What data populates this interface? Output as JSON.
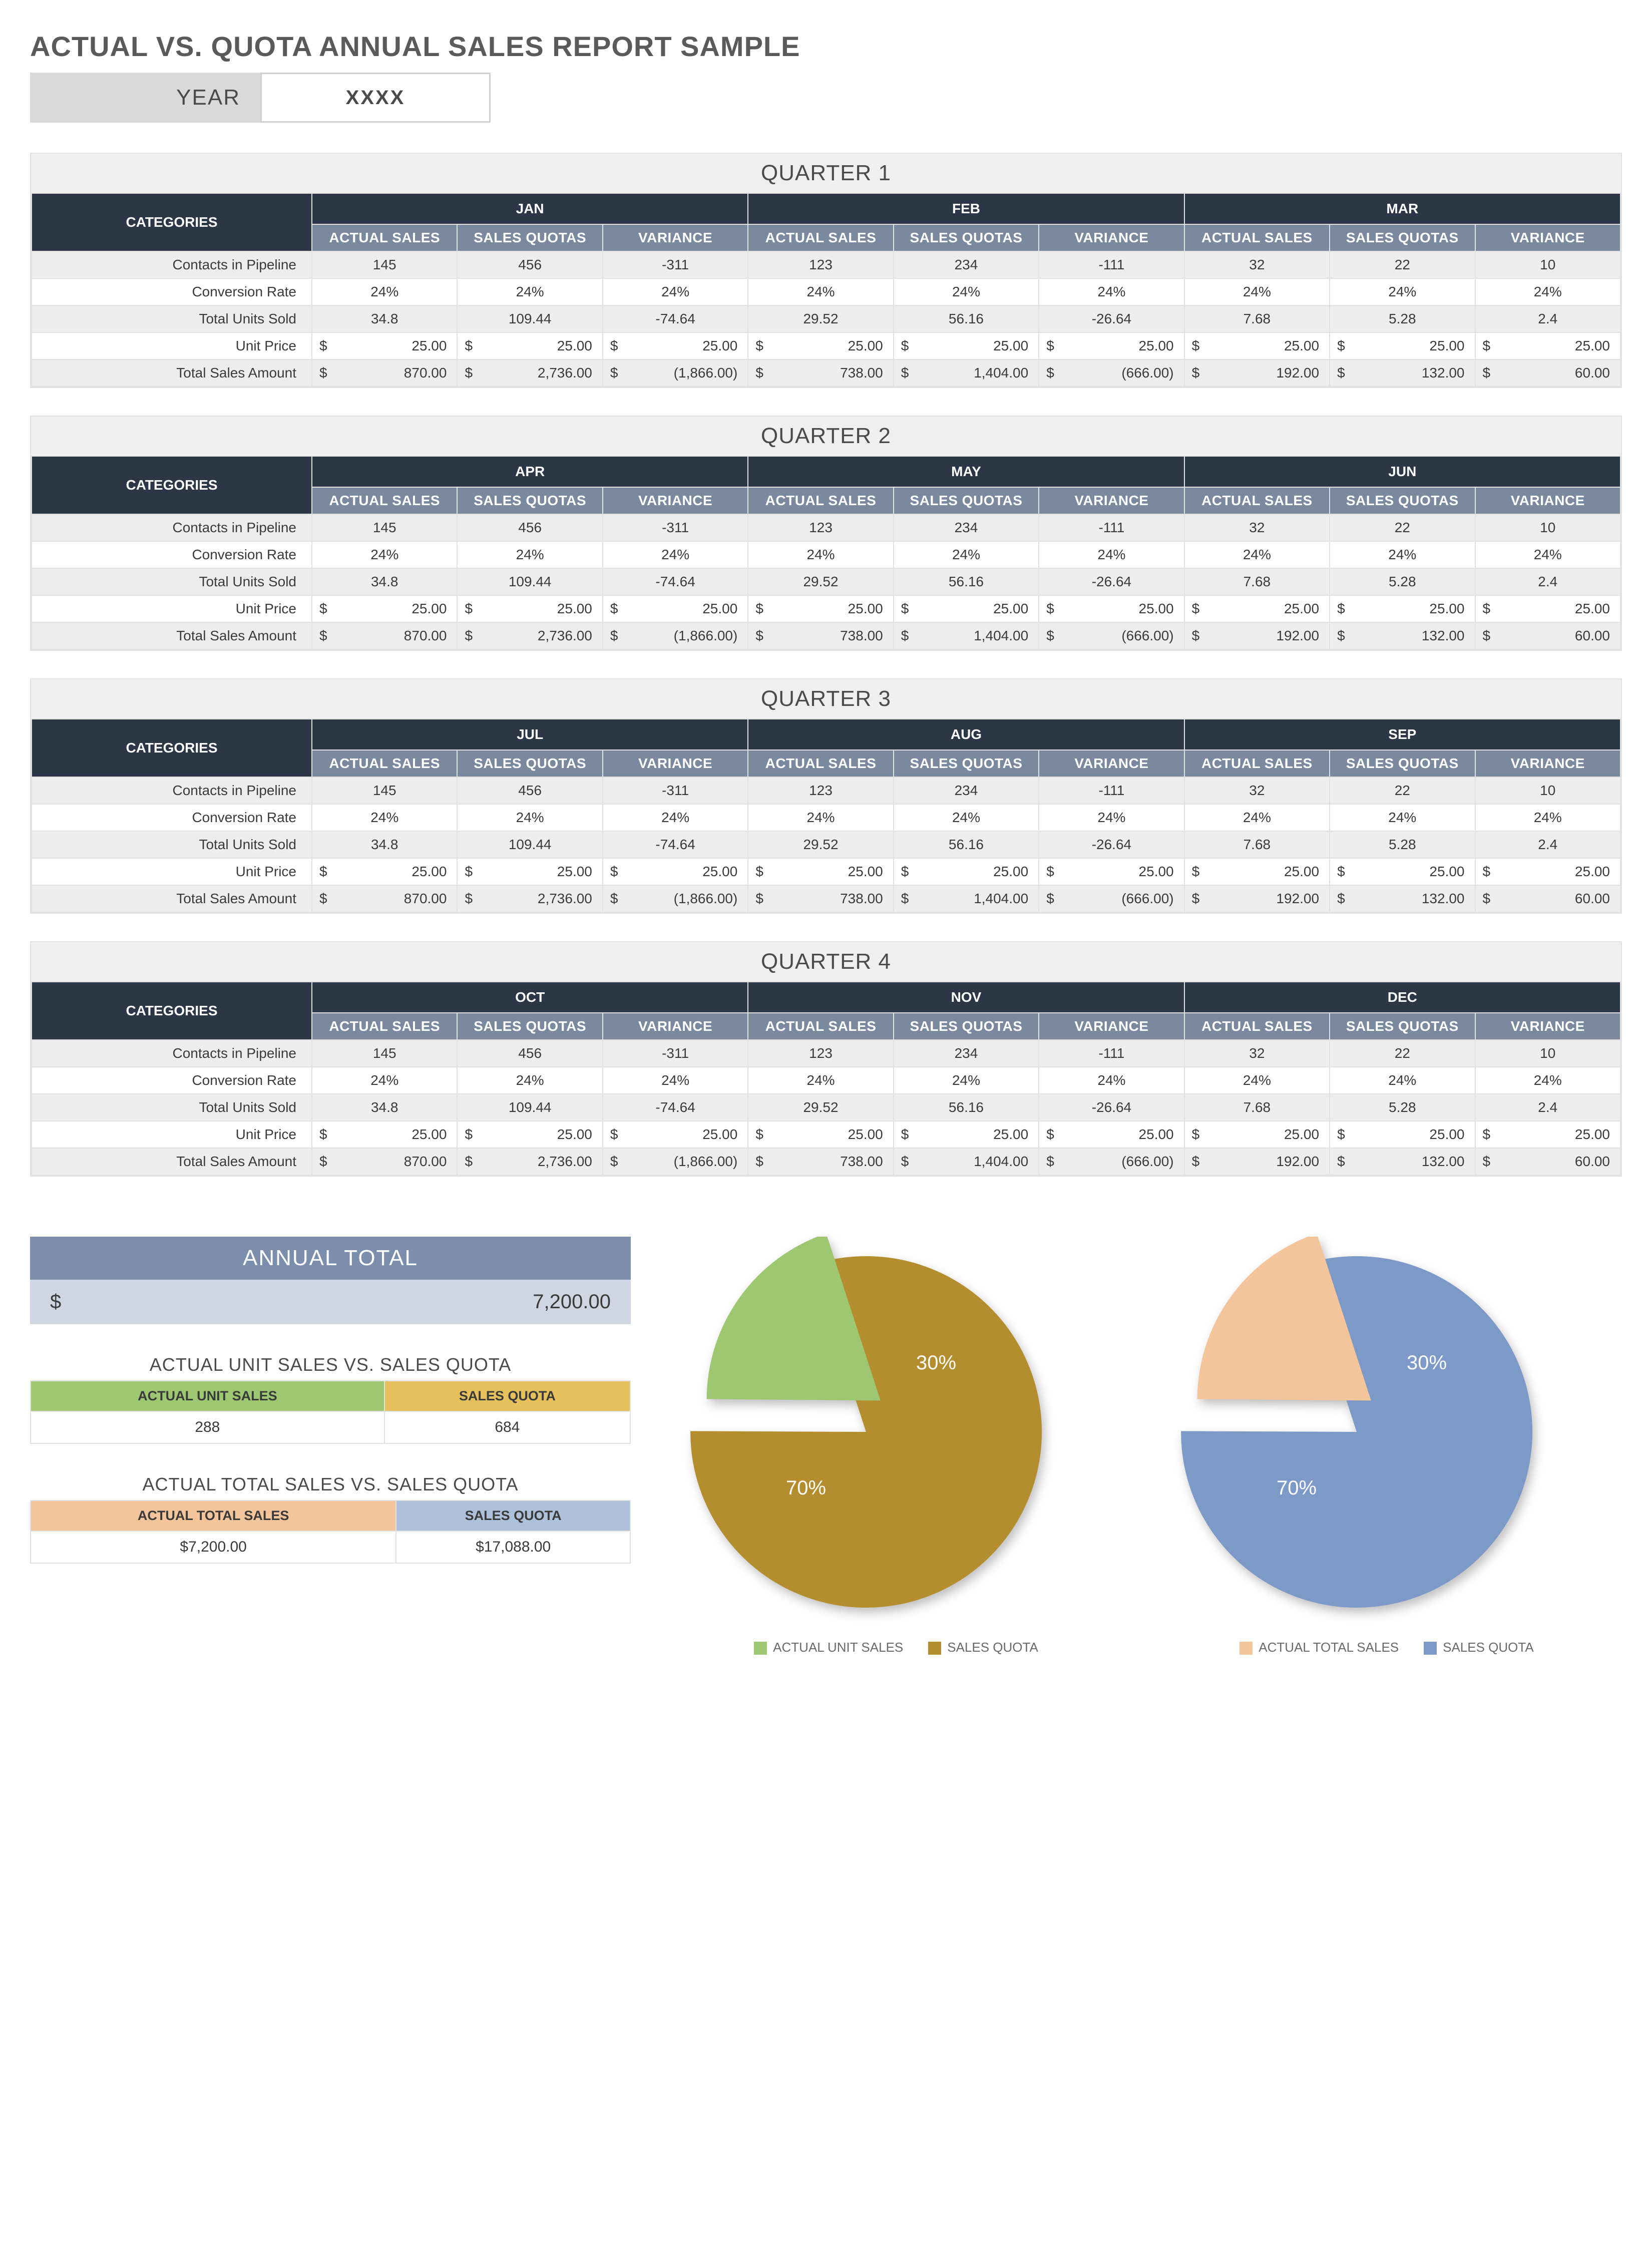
{
  "report": {
    "title": "ACTUAL VS. QUOTA ANNUAL SALES REPORT SAMPLE",
    "year_label": "YEAR",
    "year_value": "XXXX"
  },
  "headers": {
    "categories": "CATEGORIES",
    "actual_sales": "ACTUAL SALES",
    "sales_quotas": "SALES QUOTAS",
    "variance": "VARIANCE"
  },
  "row_labels": {
    "contacts": "Contacts in Pipeline",
    "conversion": "Conversion Rate",
    "units": "Total Units Sold",
    "price": "Unit Price",
    "total": "Total Sales Amount"
  },
  "quarters": [
    {
      "title": "QUARTER 1",
      "months": [
        "JAN",
        "FEB",
        "MAR"
      ]
    },
    {
      "title": "QUARTER 2",
      "months": [
        "APR",
        "MAY",
        "JUN"
      ]
    },
    {
      "title": "QUARTER 3",
      "months": [
        "JUL",
        "AUG",
        "SEP"
      ]
    },
    {
      "title": "QUARTER 4",
      "months": [
        "OCT",
        "NOV",
        "DEC"
      ]
    }
  ],
  "month_template": [
    {
      "actual": "145",
      "quota": "456",
      "var": "-311"
    },
    {
      "actual": "123",
      "quota": "234",
      "var": "-111"
    },
    {
      "actual": "32",
      "quota": "22",
      "var": "10"
    }
  ],
  "conversion_template": [
    {
      "actual": "24%",
      "quota": "24%",
      "var": "24%"
    },
    {
      "actual": "24%",
      "quota": "24%",
      "var": "24%"
    },
    {
      "actual": "24%",
      "quota": "24%",
      "var": "24%"
    }
  ],
  "units_template": [
    {
      "actual": "34.8",
      "quota": "109.44",
      "var": "-74.64"
    },
    {
      "actual": "29.52",
      "quota": "56.16",
      "var": "-26.64"
    },
    {
      "actual": "7.68",
      "quota": "5.28",
      "var": "2.4"
    }
  ],
  "price_template": [
    {
      "actual": "25.00",
      "quota": "25.00",
      "var": "25.00"
    },
    {
      "actual": "25.00",
      "quota": "25.00",
      "var": "25.00"
    },
    {
      "actual": "25.00",
      "quota": "25.00",
      "var": "25.00"
    }
  ],
  "total_template": [
    {
      "actual": "870.00",
      "quota": "2,736.00",
      "var": "(1,866.00)"
    },
    {
      "actual": "738.00",
      "quota": "1,404.00",
      "var": "(666.00)"
    },
    {
      "actual": "192.00",
      "quota": "132.00",
      "var": "60.00"
    }
  ],
  "annual": {
    "label": "ANNUAL TOTAL",
    "currency": "$",
    "value": "7,200.00"
  },
  "summary_units": {
    "title": "ACTUAL UNIT SALES VS. SALES QUOTA",
    "h1": "ACTUAL UNIT SALES",
    "h2": "SALES QUOTA",
    "v1": "288",
    "v2": "684"
  },
  "summary_totals": {
    "title": "ACTUAL TOTAL SALES VS. SALES QUOTA",
    "h1": "ACTUAL TOTAL SALES",
    "h2": "SALES QUOTA",
    "v1": "$7,200.00",
    "v2": "$17,088.00"
  },
  "pie1": {
    "pct1": "30%",
    "pct2": "70%",
    "leg1": "ACTUAL UNIT SALES",
    "leg2": "SALES QUOTA"
  },
  "pie2": {
    "pct1": "30%",
    "pct2": "70%",
    "leg1": "ACTUAL TOTAL SALES",
    "leg2": "SALES QUOTA"
  },
  "chart_data": [
    {
      "type": "pie",
      "title": "Actual Unit Sales vs Sales Quota",
      "series": [
        {
          "name": "ACTUAL UNIT SALES",
          "value": 288,
          "pct": 30
        },
        {
          "name": "SALES QUOTA",
          "value": 684,
          "pct": 70
        }
      ]
    },
    {
      "type": "pie",
      "title": "Actual Total Sales vs Sales Quota",
      "series": [
        {
          "name": "ACTUAL TOTAL SALES",
          "value": 7200.0,
          "pct": 30
        },
        {
          "name": "SALES QUOTA",
          "value": 17088.0,
          "pct": 70
        }
      ]
    },
    {
      "type": "table",
      "title": "Quarterly month data (repeated each quarter)",
      "rows": [
        {
          "metric": "Contacts in Pipeline",
          "m1": {
            "actual": 145,
            "quota": 456,
            "variance": -311
          },
          "m2": {
            "actual": 123,
            "quota": 234,
            "variance": -111
          },
          "m3": {
            "actual": 32,
            "quota": 22,
            "variance": 10
          }
        },
        {
          "metric": "Conversion Rate",
          "m1": {
            "actual": "24%",
            "quota": "24%",
            "variance": "24%"
          },
          "m2": {
            "actual": "24%",
            "quota": "24%",
            "variance": "24%"
          },
          "m3": {
            "actual": "24%",
            "quota": "24%",
            "variance": "24%"
          }
        },
        {
          "metric": "Total Units Sold",
          "m1": {
            "actual": 34.8,
            "quota": 109.44,
            "variance": -74.64
          },
          "m2": {
            "actual": 29.52,
            "quota": 56.16,
            "variance": -26.64
          },
          "m3": {
            "actual": 7.68,
            "quota": 5.28,
            "variance": 2.4
          }
        },
        {
          "metric": "Unit Price",
          "m1": {
            "actual": 25.0,
            "quota": 25.0,
            "variance": 25.0
          },
          "m2": {
            "actual": 25.0,
            "quota": 25.0,
            "variance": 25.0
          },
          "m3": {
            "actual": 25.0,
            "quota": 25.0,
            "variance": 25.0
          }
        },
        {
          "metric": "Total Sales Amount",
          "m1": {
            "actual": 870.0,
            "quota": 2736.0,
            "variance": -1866.0
          },
          "m2": {
            "actual": 738.0,
            "quota": 1404.0,
            "variance": -666.0
          },
          "m3": {
            "actual": 192.0,
            "quota": 132.0,
            "variance": 60.0
          }
        }
      ]
    }
  ]
}
